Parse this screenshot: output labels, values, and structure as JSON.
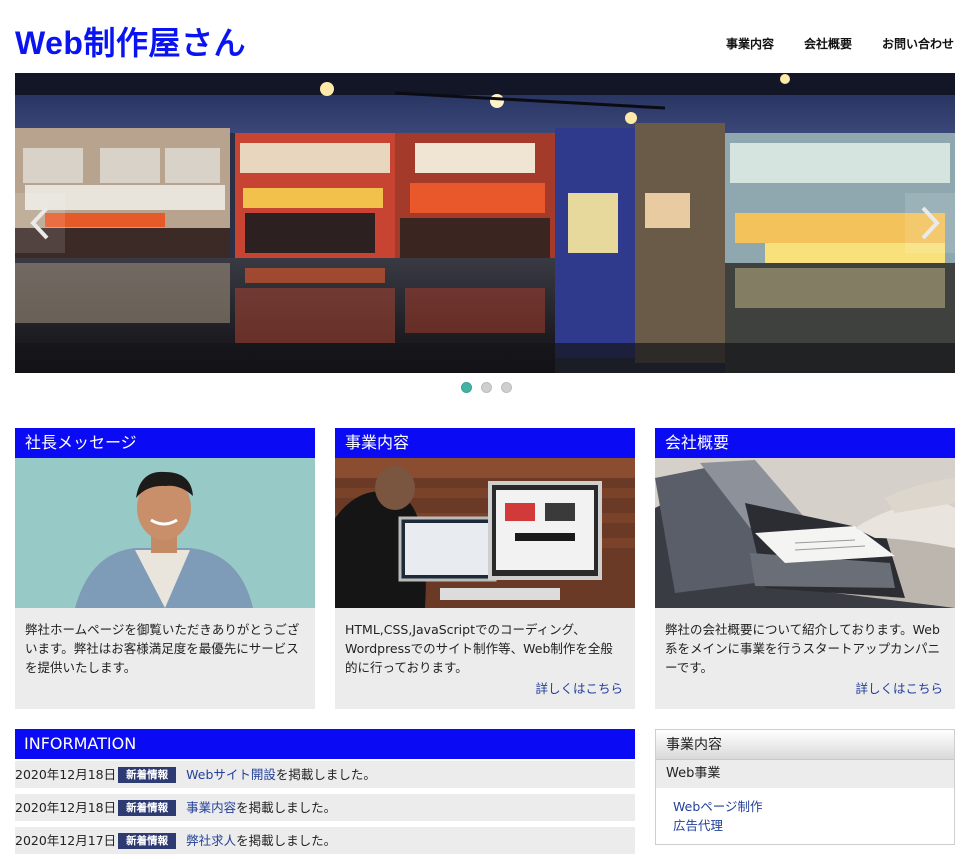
{
  "header": {
    "site_title": "Web制作屋さん",
    "nav": [
      "事業内容",
      "会社概要",
      "お問い合わせ"
    ]
  },
  "slider": {
    "active_index": 0,
    "slide_count": 3,
    "prev_icon": "chevron-left-icon",
    "next_icon": "chevron-right-icon"
  },
  "cards": [
    {
      "title": "社長メッセージ",
      "text": "弊社ホームページを御覧いただきありがとうございます。弊社はお客様満足度を最優先にサービスを提供いたします。",
      "more": ""
    },
    {
      "title": "事業内容",
      "text": "HTML,CSS,JavaScriptでのコーディング、Wordpressでのサイト制作等、Web制作を全般的に行っております。",
      "more": "詳しくはこちら"
    },
    {
      "title": "会社概要",
      "text": "弊社の会社概要について紹介しております。Web系をメインに事業を行うスタートアップカンパニーです。",
      "more": "詳しくはこちら"
    }
  ],
  "information": {
    "title": "INFORMATION",
    "badge": "新着情報",
    "rows": [
      {
        "date": "2020年12月18日",
        "link": "Webサイト開設",
        "suffix": "を掲載しました。"
      },
      {
        "date": "2020年12月18日",
        "link": "事業内容",
        "suffix": "を掲載しました。"
      },
      {
        "date": "2020年12月17日",
        "link": "弊社求人",
        "suffix": "を掲載しました。"
      }
    ]
  },
  "sidebar": {
    "title": "事業内容",
    "subtitle": "Web事業",
    "items": [
      "Webページ制作",
      "広告代理"
    ]
  },
  "colors": {
    "brand_blue": "#0a14f0",
    "header_bar": "#0a0af5",
    "link": "#23419a",
    "badge": "#2e3b73",
    "dot_active": "#42b3a5"
  }
}
